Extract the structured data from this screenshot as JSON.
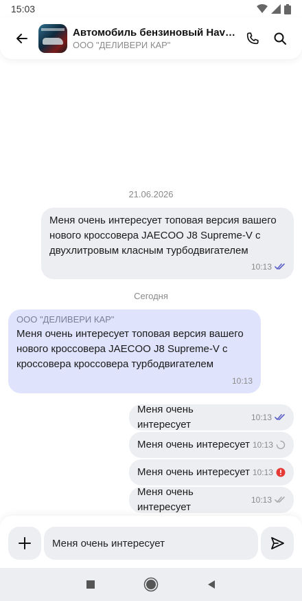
{
  "status_bar": {
    "time": "15:03"
  },
  "header": {
    "title": "Автомобиль бензиновый Haval J...",
    "subtitle": "ООО \"ДЕЛИВЕРИ КАР\""
  },
  "chat": {
    "date1": "21.06.2026",
    "date2": "Сегодня",
    "messages": [
      {
        "text": "Меня очень интересует топовая версия вашего нового кроссовера JAECOO J8 Supreme-V с двухлитровым класным турбодвигателем",
        "time": "10:13",
        "status": "read"
      },
      {
        "sender": "ООО \"ДЕЛИВЕРИ КАР\"",
        "text": "Меня очень интересует топовая версия вашего нового кроссовера JAECOO J8 Supreme-V с кроссовера кроссовера турбодвигателем",
        "time": "10:13"
      },
      {
        "text": "Меня очень интересует",
        "time": "10:13",
        "status": "read"
      },
      {
        "text": "Меня очень интересует",
        "time": "10:13",
        "status": "sending"
      },
      {
        "text": "Меня очень интересует",
        "time": "10:13",
        "status": "error"
      },
      {
        "text": "Меня очень интересует",
        "time": "10:13",
        "status": "delivered"
      }
    ]
  },
  "composer": {
    "value": "Меня очень интересует"
  },
  "colors": {
    "accent": "#5b5fc7",
    "incoming_bubble": "#dfe3fb",
    "outgoing_bubble": "#eceef1",
    "error": "#e53935"
  }
}
